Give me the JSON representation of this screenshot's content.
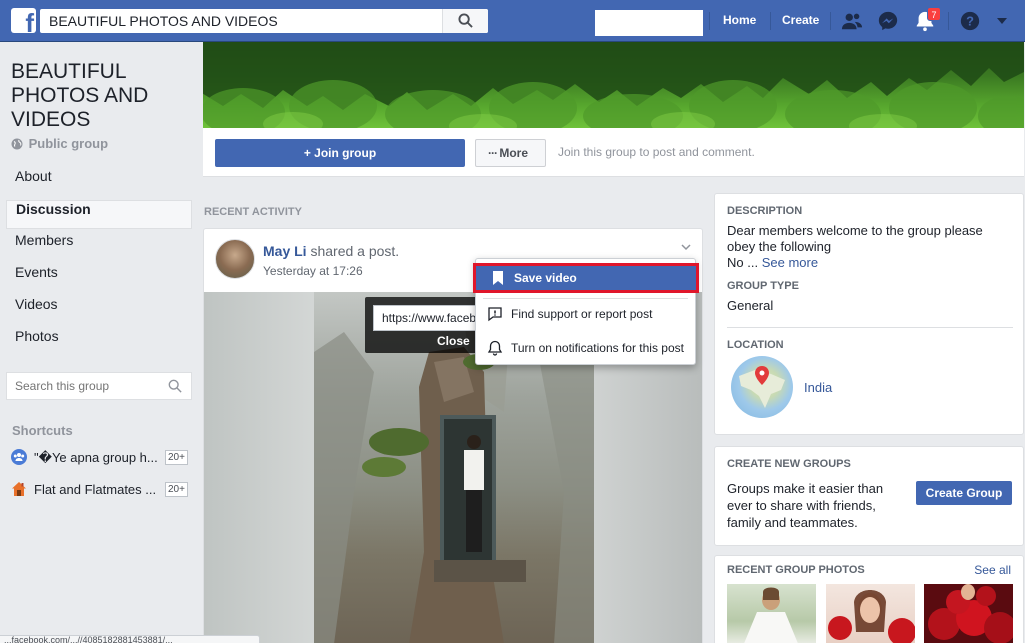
{
  "topbar": {
    "logo_letter": "f",
    "search_value": "BEAUTIFUL PHOTOS AND VIDEOS",
    "nav": {
      "home": "Home",
      "create": "Create"
    },
    "notification_count": "7",
    "brand_color": "#4267b2"
  },
  "left": {
    "group_name": "BEAUTIFUL PHOTOS AND VIDEOS",
    "privacy": "Public group",
    "nav_items": [
      "About",
      "Discussion",
      "Members",
      "Events",
      "Videos",
      "Photos"
    ],
    "active_nav": "Discussion",
    "search_placeholder": "Search this group",
    "shortcuts_title": "Shortcuts",
    "shortcuts": [
      {
        "label": "\"�Ye apna group h...",
        "count": "20+",
        "icon": "group-icon"
      },
      {
        "label": "Flat and Flatmates ...",
        "count": "20+",
        "icon": "house-icon"
      }
    ]
  },
  "actions": {
    "join_label": "Join group",
    "more_label": "More",
    "hint": "Join this group to post and comment."
  },
  "feed": {
    "section_title": "RECENT ACTIVITY",
    "post": {
      "author": "May Li",
      "action": "shared a post.",
      "time": "Yesterday at 17:26"
    },
    "url_tip": {
      "url": "https://www.faceb",
      "close": "Close"
    }
  },
  "post_menu": {
    "items": [
      {
        "label": "Save video",
        "icon": "bookmark-icon"
      },
      {
        "label": "Find support or report post",
        "icon": "report-icon"
      },
      {
        "label": "Turn on notifications for this post",
        "icon": "bell-icon"
      }
    ],
    "highlight_color": "#e0162b"
  },
  "right": {
    "description": {
      "title": "DESCRIPTION",
      "text_line1": "Dear members welcome to the group please",
      "text_line2": "obey the following",
      "text_line3": "No ...",
      "see_more": "See more"
    },
    "group_type": {
      "title": "GROUP TYPE",
      "value": "General"
    },
    "location": {
      "title": "LOCATION",
      "value": "India"
    },
    "create_groups": {
      "title": "CREATE NEW GROUPS",
      "text_line1": "Groups make it easier than",
      "text_line2": "ever to share with friends,",
      "text_line3": "family and teammates.",
      "button": "Create Group"
    },
    "recent_photos": {
      "title": "RECENT GROUP PHOTOS",
      "see_all": "See all"
    }
  },
  "status_bar": {
    "text": "...facebook.com/...//4085182881453881/..."
  }
}
